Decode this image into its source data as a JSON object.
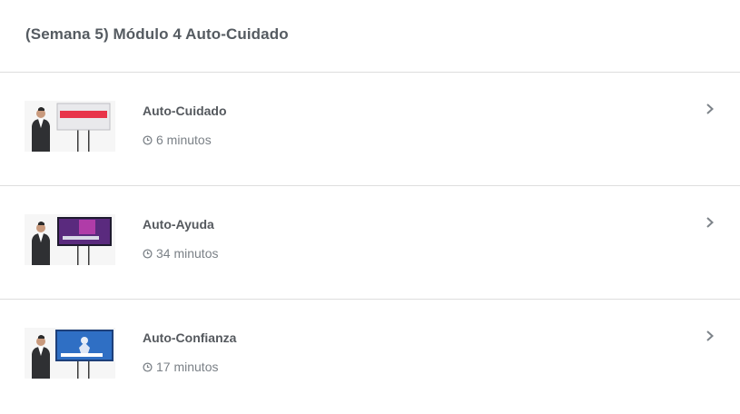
{
  "module": {
    "title": "(Semana 5) Módulo 4 Auto-Cuidado"
  },
  "lessons": [
    {
      "title": "Auto-Cuidado",
      "duration": "6 minutos",
      "thumbnail": {
        "screen_text": "AUTO-CUIDADO",
        "screen_color": "#e8344a",
        "frame_color": "#f2f2f4"
      }
    },
    {
      "title": "Auto-Ayuda",
      "duration": "34 minutos",
      "thumbnail": {
        "screen_text": "AUTO-AYUDA",
        "screen_color": "#5a2a7e",
        "frame_color": "#1e1a2e"
      }
    },
    {
      "title": "Auto-Confianza",
      "duration": "17 minutos",
      "thumbnail": {
        "screen_text": "AUTOCONFIANZA",
        "screen_color": "#2f6fc4",
        "frame_color": "#1d3f7a"
      }
    }
  ],
  "icons": {
    "duration": "clock-icon",
    "open": "chevron-right-icon"
  }
}
